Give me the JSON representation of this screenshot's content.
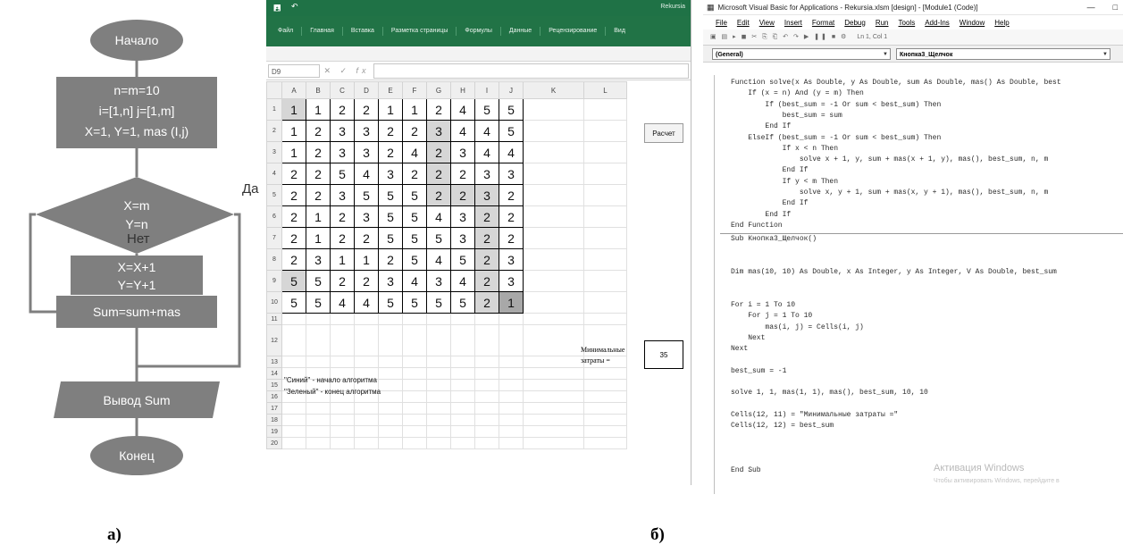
{
  "flowchart": {
    "start": "Начало",
    "init_1": "n=m=10",
    "init_2": "i=[1,n]  j=[1,m]",
    "init_3": "X=1, Y=1, mas (I,j)",
    "condition_1": "X=m",
    "condition_2": "Y=n",
    "yes_label": "Да",
    "no_label": "Нет",
    "step_1": "X=X+1",
    "step_2": "Y=Y+1",
    "sum": "Sum=sum+mas",
    "output": "Вывод Sum",
    "end": "Конец"
  },
  "excel": {
    "title_right": "Rekursia",
    "tabs": [
      "Файл",
      "Главная",
      "Вставка",
      "Разметка страницы",
      "Формулы",
      "Данные",
      "Рецензирование",
      "Вид"
    ],
    "namebox": "D9",
    "fx": "fx",
    "columns": [
      "A",
      "B",
      "C",
      "D",
      "E",
      "F",
      "G",
      "H",
      "I",
      "J",
      "K",
      "L"
    ],
    "grid": [
      [
        1,
        1,
        2,
        2,
        1,
        1,
        2,
        4,
        5,
        5
      ],
      [
        1,
        2,
        3,
        3,
        2,
        2,
        3,
        4,
        4,
        5
      ],
      [
        1,
        2,
        3,
        3,
        2,
        4,
        2,
        3,
        4,
        4
      ],
      [
        2,
        2,
        5,
        4,
        3,
        2,
        2,
        2,
        3,
        3
      ],
      [
        2,
        2,
        3,
        5,
        5,
        5,
        2,
        2,
        3,
        2
      ],
      [
        2,
        1,
        2,
        3,
        5,
        5,
        4,
        3,
        2,
        2
      ],
      [
        2,
        1,
        2,
        2,
        5,
        5,
        5,
        3,
        2,
        2
      ],
      [
        2,
        3,
        1,
        1,
        2,
        5,
        4,
        5,
        2,
        3
      ],
      [
        5,
        5,
        2,
        2,
        3,
        4,
        3,
        4,
        2,
        3
      ],
      [
        5,
        5,
        4,
        4,
        5,
        5,
        5,
        5,
        2,
        1
      ]
    ],
    "row_numbers": [
      "1",
      "2",
      "3",
      "4",
      "5",
      "6",
      "7",
      "8",
      "9",
      "10",
      "11",
      "12",
      "13",
      "14",
      "15",
      "16",
      "17",
      "18",
      "19",
      "20"
    ],
    "button_label": "Расчет",
    "min_cost_label_1": "Минимальные",
    "min_cost_label_2": "затраты =",
    "min_cost_value": "35",
    "note_1": "\"Синий\" - начало алгоритма",
    "note_2": "\"Зеленый\" - конец алгоритма"
  },
  "vba": {
    "title": "Microsoft Visual Basic for Applications - Rekursia.xlsm [design] - [Module1 (Code)]",
    "menu": [
      "File",
      "Edit",
      "View",
      "Insert",
      "Format",
      "Debug",
      "Run",
      "Tools",
      "Add-Ins",
      "Window",
      "Help"
    ],
    "toolbar_status": "Ln 1, Col 1",
    "combo_left": "(General)",
    "combo_right": "Кнопка3_Щелчок",
    "code_top": [
      "Function solve(x As Double, y As Double, sum As Double, mas() As Double, best",
      "    If (x = n) And (y = m) Then",
      "        If (best_sum = -1 Or sum < best_sum) Then",
      "            best_sum = sum",
      "        End If",
      "    ElseIf (best_sum = -1 Or sum < best_sum) Then",
      "            If x < n Then",
      "                solve x + 1, y, sum + mas(x + 1, y), mas(), best_sum, n, m",
      "            End If",
      "            If y < m Then",
      "                solve x, y + 1, sum + mas(x, y + 1), mas(), best_sum, n, m",
      "            End If",
      "        End If",
      "End Function"
    ],
    "code_bottom": [
      "Sub Кнопка3_Щелчок()",
      "",
      "",
      "Dim mas(10, 10) As Double, x As Integer, y As Integer, V As Double, best_sum",
      "",
      "",
      "For i = 1 To 10",
      "    For j = 1 To 10",
      "        mas(i, j) = Cells(i, j)",
      "    Next",
      "Next",
      "",
      "best_sum = -1",
      "",
      "solve 1, 1, mas(1, 1), mas(), best_sum, 10, 10",
      "",
      "Cells(12, 11) = \"Минимальные затраты =\"",
      "Cells(12, 12) = best_sum",
      "",
      "",
      "",
      "End Sub"
    ],
    "watermark_1": "Активация Windows",
    "watermark_2": "Чтобы активировать Windows, перейдите в"
  },
  "captions": {
    "a": "а)",
    "b": "б)"
  },
  "colors": {
    "flow_fill": "#7f7f7f",
    "excel_green": "#217346"
  }
}
